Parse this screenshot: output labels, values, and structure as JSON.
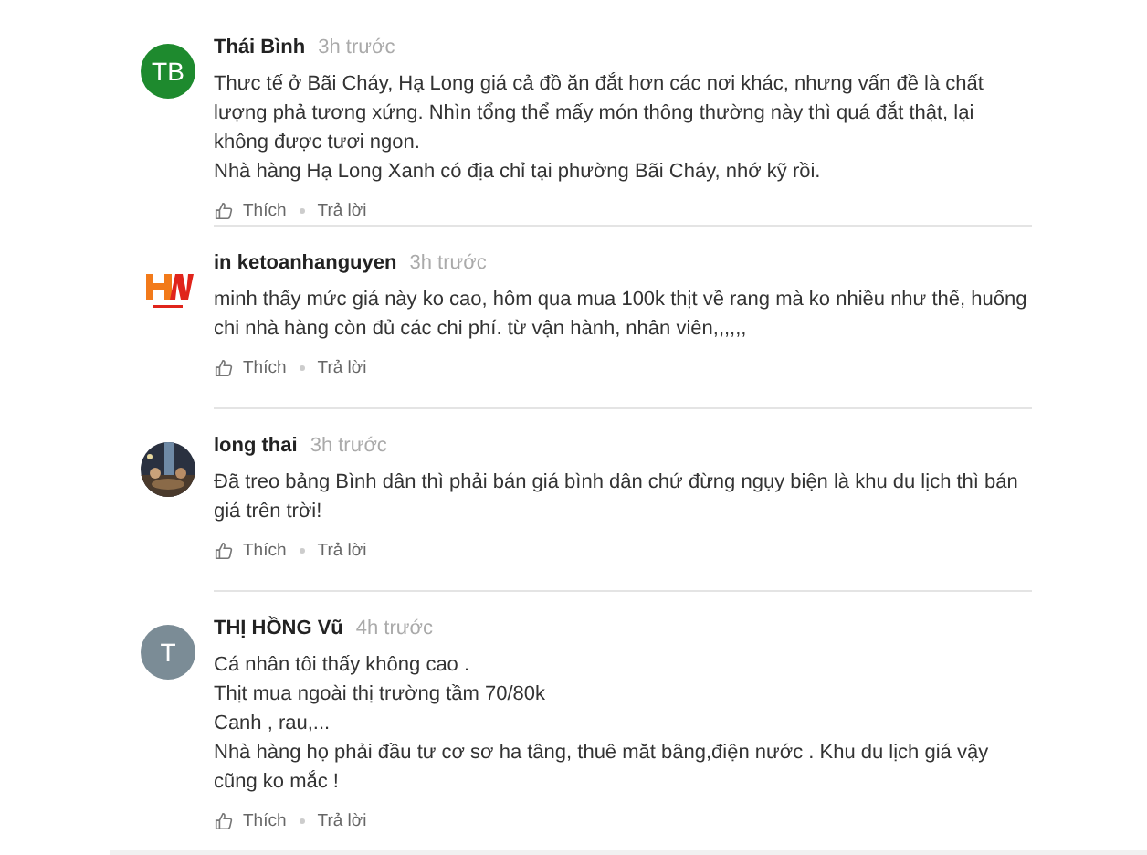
{
  "comments": [
    {
      "avatar": {
        "kind": "initials",
        "initials": "TB",
        "color": "#1e8a2e"
      },
      "author": "Thái Bình",
      "time": "3h trước",
      "paragraphs": [
        "Thưc tế ở Bãi Cháy, Hạ Long giá cả đồ ăn đắt hơn các nơi khác, nhưng vấn đề là chất lượng phả tương xứng. Nhìn tổng thể mấy món thông thường này thì quá đắt thật, lại không được tươi ngon.",
        "Nhà hàng Hạ Long Xanh có địa chỉ tại phường Bãi Cháy, nhớ kỹ rồi."
      ],
      "like": "Thích",
      "reply": "Trả lời"
    },
    {
      "avatar": {
        "kind": "logo"
      },
      "author": "in ketoanhanguyen",
      "time": "3h trước",
      "paragraphs": [
        "minh thấy mức giá này ko cao, hôm qua mua 100k thịt về rang mà ko nhiều như thế, huống chi nhà hàng còn đủ các chi phí. từ vận hành, nhân viên,,,,,,"
      ],
      "like": "Thích",
      "reply": "Trả lời"
    },
    {
      "avatar": {
        "kind": "picture"
      },
      "author": "long thai",
      "time": "3h trước",
      "paragraphs": [
        "Đã treo bảng Bình dân thì phải bán giá bình dân chứ đừng ngụy biện là khu du lịch thì bán giá trên trời!"
      ],
      "like": "Thích",
      "reply": "Trả lời"
    },
    {
      "avatar": {
        "kind": "initials",
        "initials": "T",
        "color": "#7b8c96"
      },
      "author": "THỊ HỒNG Vũ",
      "time": "4h trước",
      "paragraphs": [
        "Cá nhân tôi thấy không cao .",
        "Thịt mua ngoài thị trường tầm 70/80k",
        "Canh , rau,...",
        "Nhà hàng họ phải đầu tư cơ sơ ha tâng, thuê măt bâng,điện nước . Khu du lịch giá vậy cũng ko mắc !"
      ],
      "like": "Thích",
      "reply": "Trả lời"
    }
  ]
}
